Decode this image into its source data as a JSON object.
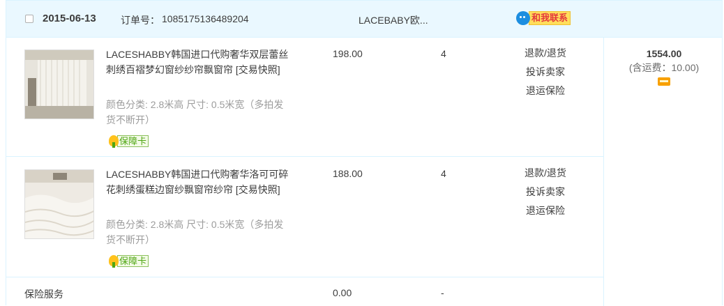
{
  "header": {
    "date": "2015-06-13",
    "order_label": "订单号：",
    "order_no": "1085175136489204",
    "shop": "LACEBABY欧...",
    "contact_label": "和我联系"
  },
  "items": [
    {
      "title": "LACESHABBY韩国进口代购奢华双层蕾丝刺绣百褶梦幻窗纱纱帘飘窗帘 [交易快照]",
      "sku": "颜色分类: 2.8米高  尺寸: 0.5米宽（多拍发货不断开）",
      "badge": "保障卡",
      "price": "198.00",
      "qty": "4",
      "actions": [
        "退款/退货",
        "投诉卖家",
        "退运保险"
      ]
    },
    {
      "title": "LACESHABBY韩国进口代购奢华洛可可碎花刺绣蛋糕边窗纱飘窗帘纱帘 [交易快照]",
      "sku": "颜色分类: 2.8米高  尺寸: 0.5米宽（多拍发货不断开）",
      "badge": "保障卡",
      "price": "188.00",
      "qty": "4",
      "actions": [
        "退款/退货",
        "投诉卖家",
        "退运保险"
      ]
    }
  ],
  "insurance": {
    "label": "保险服务",
    "price": "0.00",
    "qty": "-"
  },
  "total": {
    "amount": "1554.00",
    "shipping": "(含运费：10.00)"
  }
}
